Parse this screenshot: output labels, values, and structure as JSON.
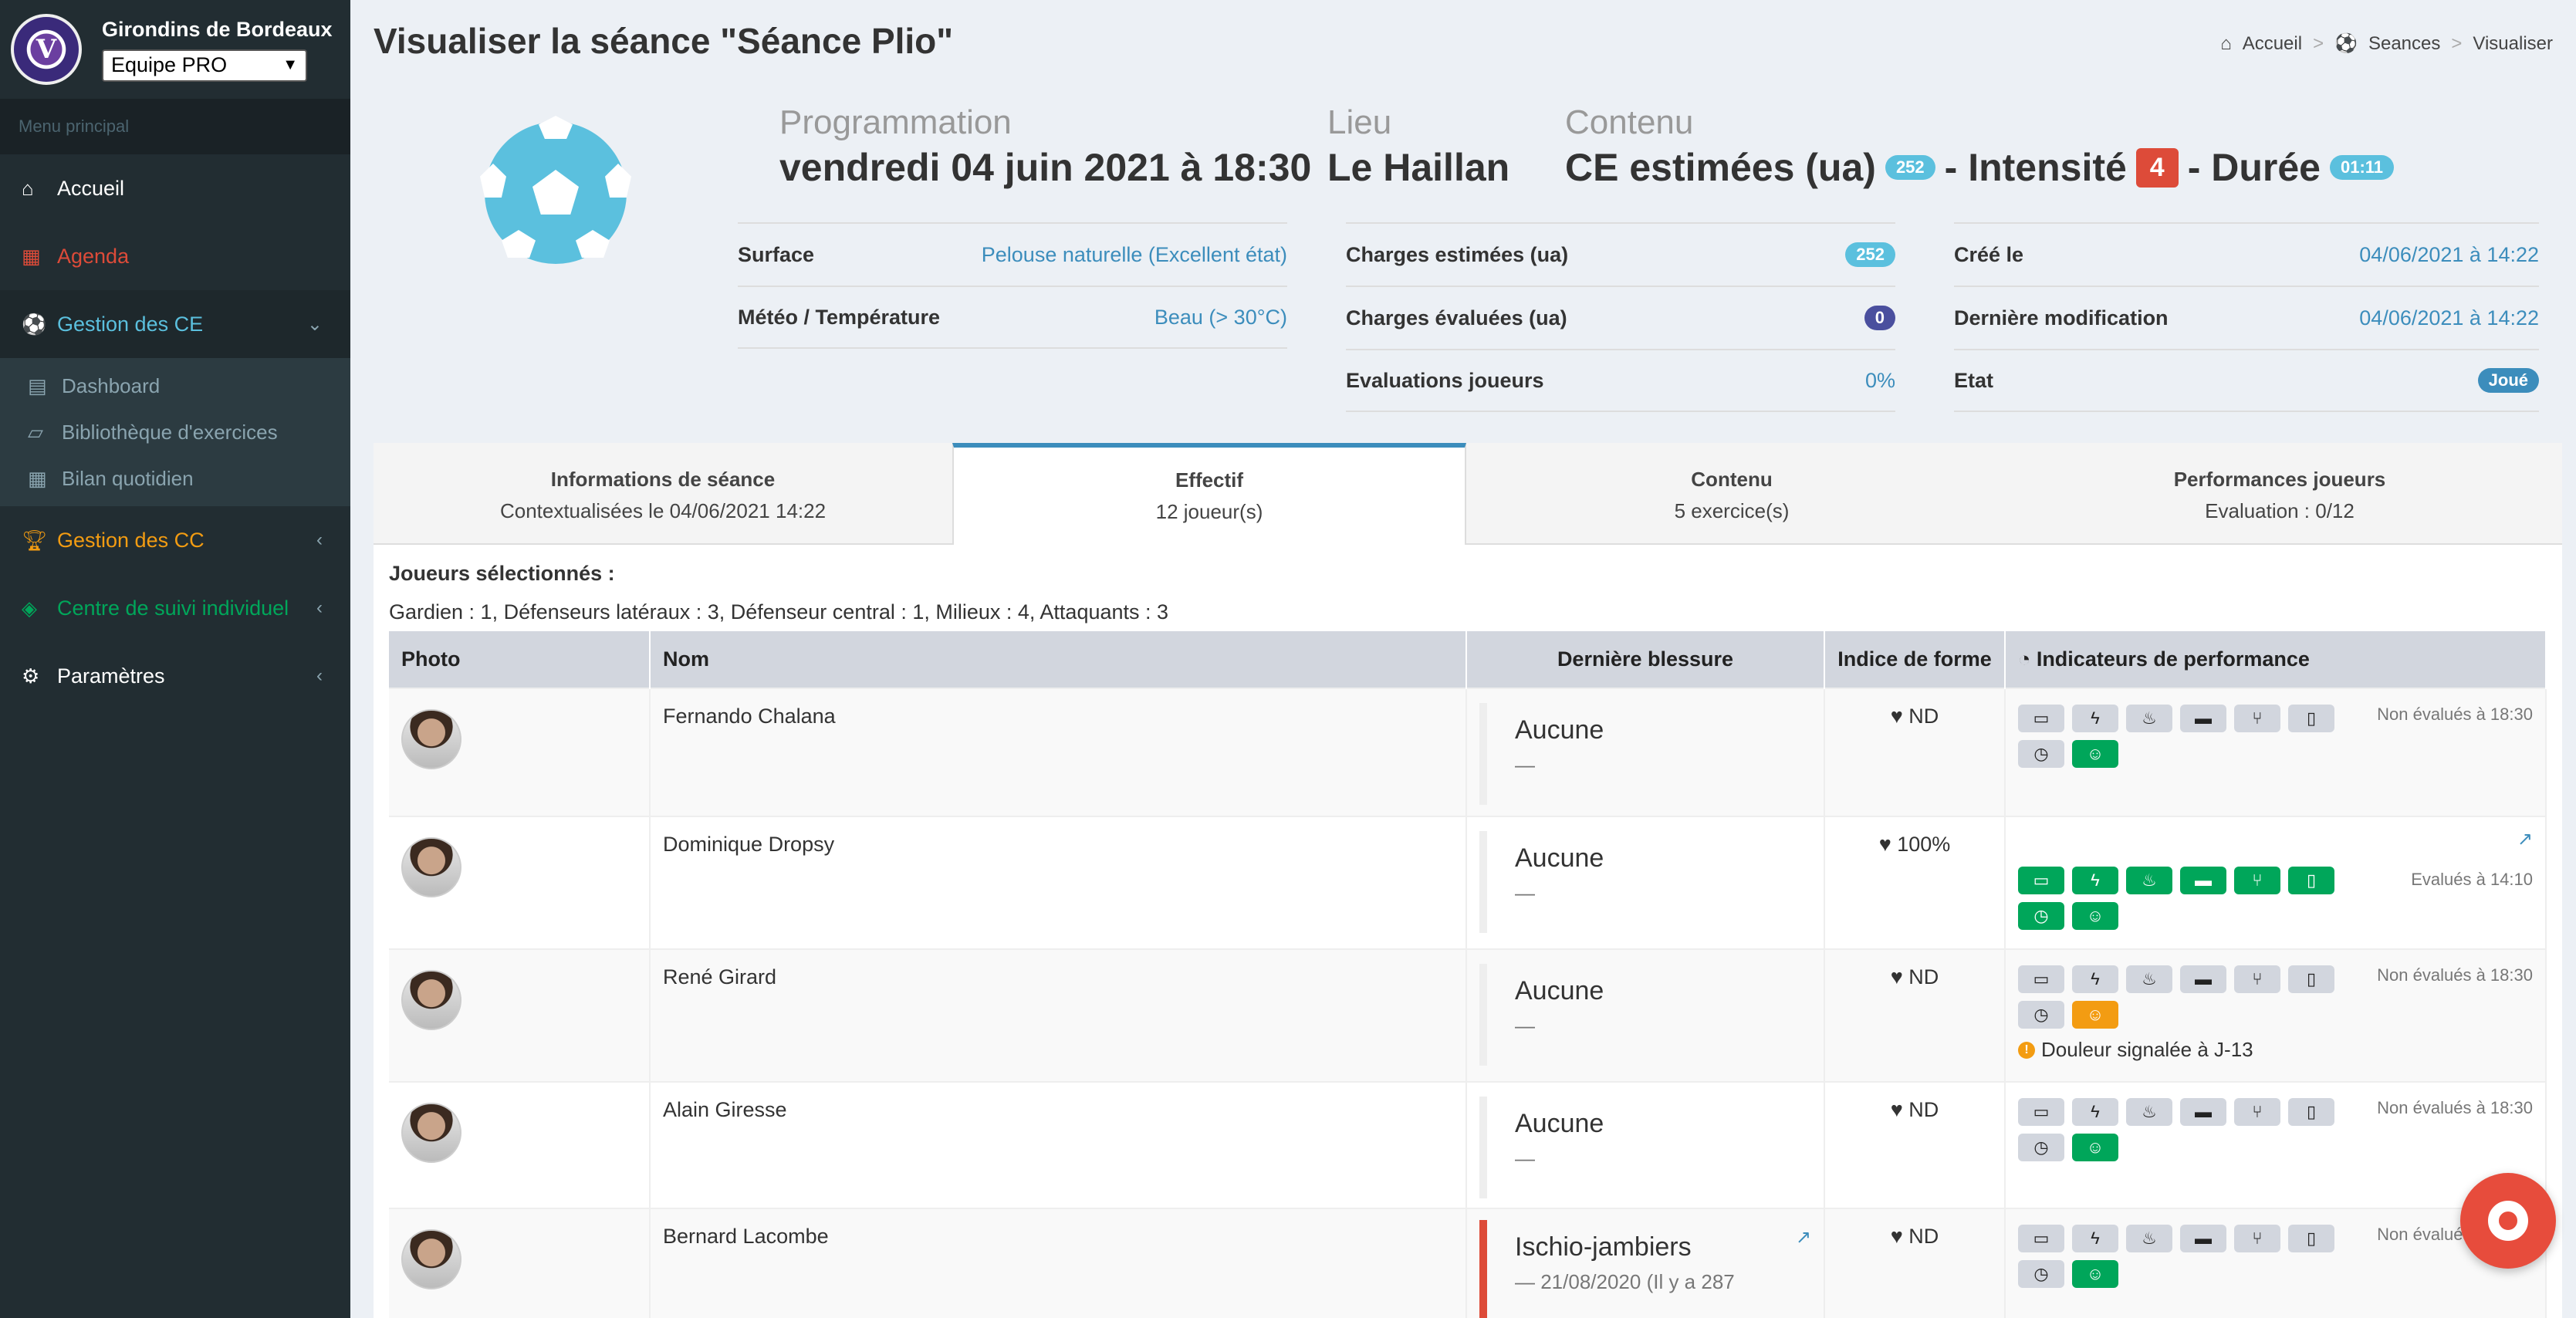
{
  "sidebar": {
    "club_name": "Girondins de Bordeaux",
    "team_select": "Equipe PRO",
    "menu_header": "Menu principal",
    "items": [
      {
        "label": "Accueil",
        "icon": "home-icon",
        "color": "#ffffff"
      },
      {
        "label": "Agenda",
        "icon": "calendar-icon",
        "color": "#dd4b39"
      },
      {
        "label": "Gestion des CE",
        "icon": "soccer-ball-icon",
        "color": "#5bc0de"
      },
      {
        "label": "Gestion des CC",
        "icon": "trophy-icon",
        "color": "#f39c12"
      },
      {
        "label": "Centre de suivi individuel",
        "icon": "cube-icon",
        "color": "#00a65a"
      },
      {
        "label": "Paramètres",
        "icon": "gear-icon",
        "color": "#ffffff"
      }
    ],
    "sub_items": [
      {
        "label": "Dashboard",
        "icon": "table-icon"
      },
      {
        "label": "Bibliothèque d'exercices",
        "icon": "book-icon"
      },
      {
        "label": "Bilan quotidien",
        "icon": "calculator-icon"
      }
    ]
  },
  "header": {
    "title": "Visualiser la séance \"Séance Plio\"",
    "breadcrumb": [
      "Accueil",
      "Seances",
      "Visualiser"
    ]
  },
  "session": {
    "programmation_label": "Programmation",
    "programmation_value": "vendredi 04 juin 2021 à 18:30",
    "lieu_label": "Lieu",
    "lieu_value": "Le Haillan",
    "contenu_label": "Contenu",
    "ce_label": "CE estimées (ua)",
    "ce_badge": "252",
    "intensite_label": "- Intensité",
    "intensite_value": "4",
    "duree_label": "- Durée",
    "duree_badge": "01:11"
  },
  "details": {
    "col1": [
      {
        "k": "Surface",
        "v": "Pelouse naturelle (Excellent état)"
      },
      {
        "k": "Météo / Température",
        "v": "Beau (> 30°C)"
      }
    ],
    "col2": [
      {
        "k": "Charges estimées (ua)",
        "v": "252"
      },
      {
        "k": "Charges évaluées (ua)",
        "v": "0"
      },
      {
        "k": "Evaluations joueurs",
        "v": "0%"
      }
    ],
    "col3": [
      {
        "k": "Créé le",
        "v": "04/06/2021 à 14:22"
      },
      {
        "k": "Dernière modification",
        "v": "04/06/2021 à 14:22"
      },
      {
        "k": "Etat",
        "v": "Joué"
      }
    ]
  },
  "tabs": [
    {
      "title": "Informations de séance",
      "sub": "Contextualisées le 04/06/2021 14:22"
    },
    {
      "title": "Effectif",
      "sub": "12 joueur(s)"
    },
    {
      "title": "Contenu",
      "sub": "5 exercice(s)"
    },
    {
      "title": "Performances joueurs",
      "sub": "Evaluation : 0/12"
    }
  ],
  "effectif": {
    "selected_label": "Joueurs sélectionnés :",
    "summary": "Gardien : 1, Défenseurs latéraux : 3, Défenseur central : 1, Milieux : 4, Attaquants : 3",
    "columns": [
      "Photo",
      "Nom",
      "Dernière blessure",
      "Indice de forme",
      "Indicateurs de performance"
    ],
    "players": [
      {
        "name": "Fernando Chalana",
        "injury": "Aucune",
        "injury_sub": "—",
        "form": "ND",
        "eval": "Non évalués à 18:30"
      },
      {
        "name": "Dominique Dropsy",
        "injury": "Aucune",
        "injury_sub": "—",
        "form": "100%",
        "eval": "Evalués à 14:10"
      },
      {
        "name": "René Girard",
        "injury": "Aucune",
        "injury_sub": "—",
        "form": "ND",
        "eval": "Non évalués à 18:30",
        "pain": "Douleur signalée à J-13"
      },
      {
        "name": "Alain Giresse",
        "injury": "Aucune",
        "injury_sub": "—",
        "form": "ND",
        "eval": "Non évalués à 18:30"
      },
      {
        "name": "Bernard Lacombe",
        "injury": "Ischio-jambiers",
        "injury_sub": "— 21/08/2020 (Il y a 287",
        "form": "ND",
        "eval": "Non évalués à 18:30"
      }
    ]
  },
  "colors": {
    "accent": "#3c8dbc",
    "sidebar": "#222d32",
    "green": "#00a65a",
    "orange": "#f39c12",
    "red": "#dd4b39"
  }
}
